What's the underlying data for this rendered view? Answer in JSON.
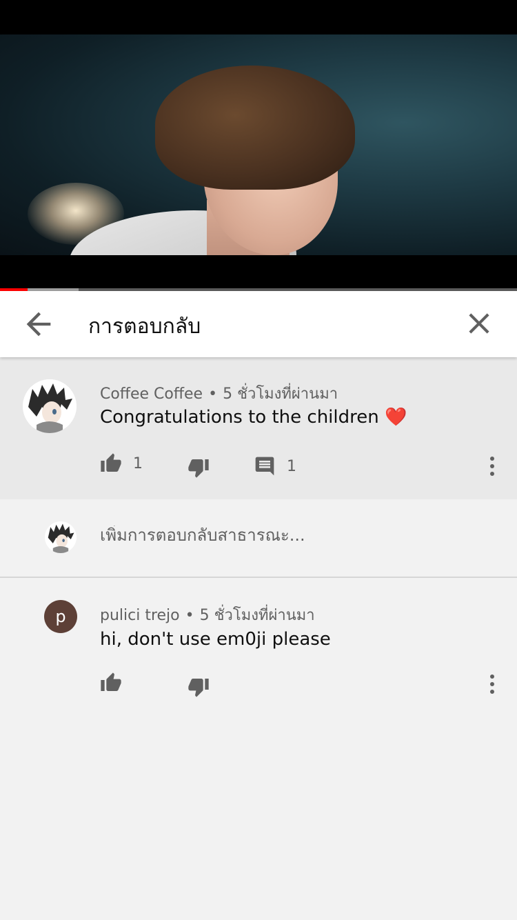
{
  "colors": {
    "progress_played": "#ff0000",
    "header_bg": "#ffffff",
    "main_comment_bg": "#e9e9e9",
    "page_bg": "#f2f2f2",
    "avatar_p_bg": "#5d4037"
  },
  "video": {
    "progress_played_fraction": 0.053,
    "progress_buffered_fraction": 0.152
  },
  "header": {
    "back_icon": "arrow-back-icon",
    "title": "การตอบกลับ",
    "close_icon": "close-icon"
  },
  "main_comment": {
    "author": "Coffee Coffee",
    "separator": "•",
    "time": "5 ชั่วโมงที่ผ่านมา",
    "text": "Congratulations to the children ❤️",
    "likes": "1",
    "replies": "1",
    "like_icon": "thumb-up-icon",
    "dislike_icon": "thumb-down-icon",
    "reply_icon": "comment-icon",
    "more_icon": "more-vert-icon"
  },
  "reply_input": {
    "placeholder": "เพิ่มการตอบกลับสาธารณะ..."
  },
  "reply": {
    "avatar_letter": "p",
    "author": "pulici trejo",
    "separator": "•",
    "time": "5 ชั่วโมงที่ผ่านมา",
    "text": "hi, don't use em0ji please",
    "like_icon": "thumb-up-icon",
    "dislike_icon": "thumb-down-icon",
    "more_icon": "more-vert-icon"
  }
}
